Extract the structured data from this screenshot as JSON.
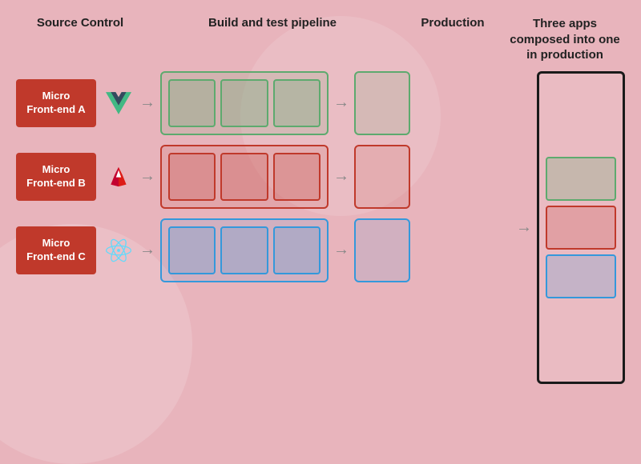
{
  "header": {
    "source_control": "Source Control",
    "pipeline": "Build and test pipeline",
    "production": "Production",
    "three_apps": "Three apps\ncomposed into one\nin production"
  },
  "rows": [
    {
      "id": "mfe-a",
      "label": "Micro\nFront-end A",
      "framework": "vue",
      "color": "green"
    },
    {
      "id": "mfe-b",
      "label": "Micro\nFront-end B",
      "framework": "angular",
      "color": "red"
    },
    {
      "id": "mfe-c",
      "label": "Micro\nFront-end C",
      "framework": "react",
      "color": "blue"
    }
  ],
  "arrow": "→"
}
